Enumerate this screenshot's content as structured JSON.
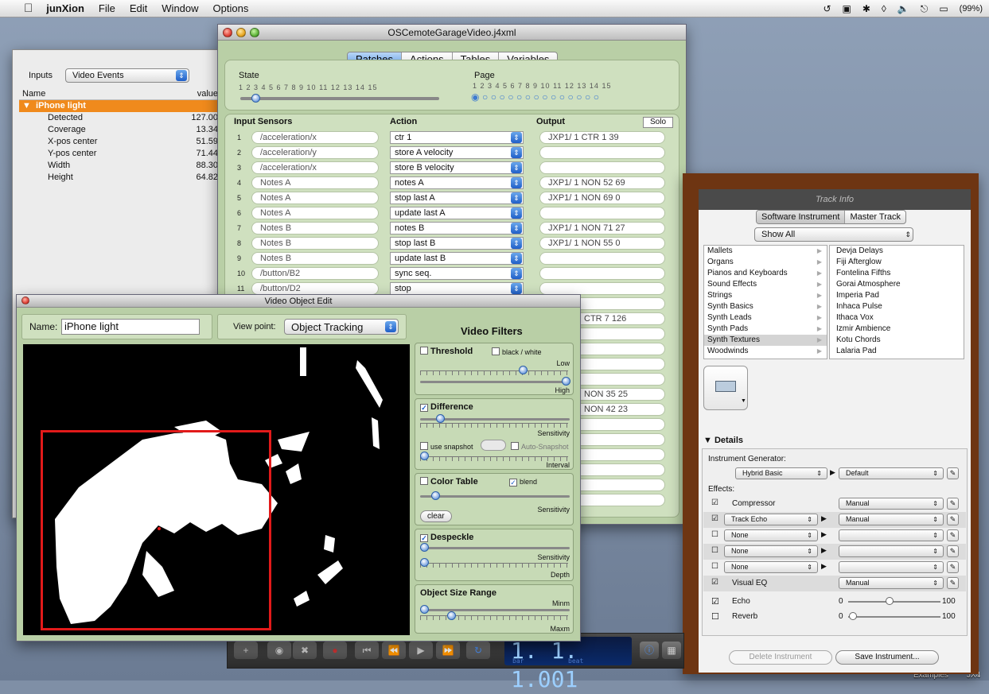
{
  "menubar": {
    "app": "junXion",
    "items": [
      "File",
      "Edit",
      "Window",
      "Options"
    ],
    "battery": "(99%)"
  },
  "inputs": {
    "label": "Inputs",
    "source": "Video Events",
    "col_name": "Name",
    "col_value": "value",
    "group": "iPhone light",
    "rows": [
      {
        "name": "Detected",
        "value": "127.00"
      },
      {
        "name": "Coverage",
        "value": "13.34"
      },
      {
        "name": "X-pos center",
        "value": "51.59"
      },
      {
        "name": "Y-pos center",
        "value": "71.44"
      },
      {
        "name": "Width",
        "value": "88.30"
      },
      {
        "name": "Height",
        "value": "64.82"
      }
    ]
  },
  "osc": {
    "title": "OSCemoteGarageVideo.j4xml",
    "tabs": [
      "Patches",
      "Actions",
      "Tables",
      "Variables"
    ],
    "active_tab": "Patches",
    "state_label": "State",
    "state_ticks": "1  2  3  4  5  6  7  8  9  10  11  12  13  14  15",
    "page_label": "Page",
    "page_ticks": "1  2  3  4  5  6  7  8  9  10  11  12  13  14  15",
    "col_input": "Input Sensors",
    "col_action": "Action",
    "col_output": "Output",
    "solo": "Solo",
    "rows": [
      {
        "n": "1",
        "sensor": "/acceleration/x",
        "action": "ctr 1",
        "output": "JXP1/ 1 CTR  1  39"
      },
      {
        "n": "2",
        "sensor": "/acceleration/y",
        "action": "store A velocity",
        "output": ""
      },
      {
        "n": "3",
        "sensor": "/acceleration/x",
        "action": "store B velocity",
        "output": ""
      },
      {
        "n": "4",
        "sensor": "Notes A",
        "action": "notes A",
        "output": "JXP1/ 1 NON  52  69"
      },
      {
        "n": "5",
        "sensor": "Notes A",
        "action": "stop last A",
        "output": "JXP1/ 1 NON  69  0"
      },
      {
        "n": "6",
        "sensor": "Notes A",
        "action": "update last A",
        "output": ""
      },
      {
        "n": "7",
        "sensor": "Notes B",
        "action": "notes B",
        "output": "JXP1/ 1 NON  71  27"
      },
      {
        "n": "8",
        "sensor": "Notes B",
        "action": "stop last B",
        "output": "JXP1/ 1 NON  55  0"
      },
      {
        "n": "9",
        "sensor": "Notes B",
        "action": "update last B",
        "output": ""
      },
      {
        "n": "10",
        "sensor": "/button/B2",
        "action": "sync seq.",
        "output": ""
      },
      {
        "n": "11",
        "sensor": "/button/D2",
        "action": "stop",
        "output": ""
      }
    ],
    "partial_outputs": [
      "CTR  7 126",
      "NON  35  25",
      "NON  42  23"
    ]
  },
  "track": {
    "title": "Track Info",
    "btn_software": "Software Instrument",
    "btn_master": "Master Track",
    "filter": "Show All",
    "categories": [
      "Mallets",
      "Organs",
      "Pianos and Keyboards",
      "Sound Effects",
      "Strings",
      "Synth Basics",
      "Synth Leads",
      "Synth Pads",
      "Synth Textures",
      "Woodwinds"
    ],
    "selected_category": "Synth Textures",
    "presets": [
      "Devja Delays",
      "Fiji Afterglow",
      "Fontelina Fifths",
      "Gorai Atmosphere",
      "Imperia Pad",
      "Inhaca Pulse",
      "Ithaca Vox",
      "Izmir Ambience",
      "Kotu Chords",
      "Lalaria Pad"
    ],
    "details": "Details",
    "instrument_generator": "Instrument Generator:",
    "generator": "Hybrid Basic",
    "generator_preset": "Default",
    "effects_label": "Effects:",
    "effects": [
      {
        "name": "Compressor",
        "preset": "Manual",
        "checked": true
      },
      {
        "name": "Track Echo",
        "preset": "Manual",
        "checked": true
      },
      {
        "name": "None",
        "preset": "",
        "checked": false
      },
      {
        "name": "None",
        "preset": "",
        "checked": false
      },
      {
        "name": "None",
        "preset": "",
        "checked": false
      },
      {
        "name": "Visual EQ",
        "preset": "Manual",
        "checked": true
      }
    ],
    "echo": {
      "label": "Echo",
      "min": "0",
      "max": "100",
      "level": 0.45
    },
    "reverb": {
      "label": "Reverb",
      "min": "0",
      "max": "100",
      "level": 0.05
    },
    "delete_btn": "Delete Instrument",
    "save_btn": "Save Instrument..."
  },
  "transport": {
    "lcd": "1. 1. 1.001",
    "bar": "bar",
    "beat": "beat"
  },
  "video": {
    "title": "Video Object Edit",
    "name_label": "Name:",
    "name_value": "iPhone light",
    "viewpoint_label": "View point:",
    "viewpoint": "Object Tracking",
    "filters_title": "Video Filters",
    "threshold": "Threshold",
    "bw": "black / white",
    "low": "Low",
    "high": "High",
    "difference": "Difference",
    "sensitivity": "Sensitivity",
    "use_snapshot": "use snapshot",
    "auto_snapshot": "Auto-Snapshot",
    "interval": "Interval",
    "color_table": "Color Table",
    "blend": "blend",
    "clear": "clear",
    "despeckle": "Despeckle",
    "depth": "Depth",
    "size_range": "Object Size Range",
    "minm": "Minm",
    "maxm": "Maxm"
  },
  "desktop": {
    "examples": "Examples",
    "jx": "JX4"
  }
}
